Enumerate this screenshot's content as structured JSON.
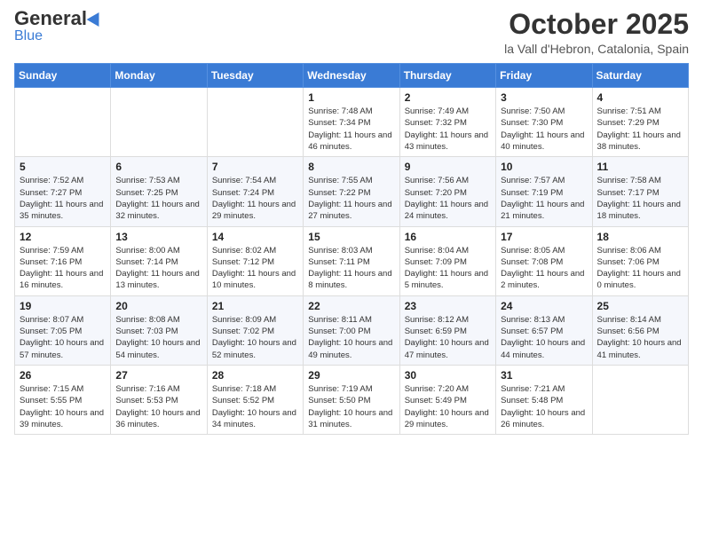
{
  "logo": {
    "general": "General",
    "blue": "Blue"
  },
  "header": {
    "title": "October 2025",
    "location": "la Vall d'Hebron, Catalonia, Spain"
  },
  "weekdays": [
    "Sunday",
    "Monday",
    "Tuesday",
    "Wednesday",
    "Thursday",
    "Friday",
    "Saturday"
  ],
  "weeks": [
    [
      {
        "day": "",
        "sunrise": "",
        "sunset": "",
        "daylight": ""
      },
      {
        "day": "",
        "sunrise": "",
        "sunset": "",
        "daylight": ""
      },
      {
        "day": "",
        "sunrise": "",
        "sunset": "",
        "daylight": ""
      },
      {
        "day": "1",
        "sunrise": "Sunrise: 7:48 AM",
        "sunset": "Sunset: 7:34 PM",
        "daylight": "Daylight: 11 hours and 46 minutes."
      },
      {
        "day": "2",
        "sunrise": "Sunrise: 7:49 AM",
        "sunset": "Sunset: 7:32 PM",
        "daylight": "Daylight: 11 hours and 43 minutes."
      },
      {
        "day": "3",
        "sunrise": "Sunrise: 7:50 AM",
        "sunset": "Sunset: 7:30 PM",
        "daylight": "Daylight: 11 hours and 40 minutes."
      },
      {
        "day": "4",
        "sunrise": "Sunrise: 7:51 AM",
        "sunset": "Sunset: 7:29 PM",
        "daylight": "Daylight: 11 hours and 38 minutes."
      }
    ],
    [
      {
        "day": "5",
        "sunrise": "Sunrise: 7:52 AM",
        "sunset": "Sunset: 7:27 PM",
        "daylight": "Daylight: 11 hours and 35 minutes."
      },
      {
        "day": "6",
        "sunrise": "Sunrise: 7:53 AM",
        "sunset": "Sunset: 7:25 PM",
        "daylight": "Daylight: 11 hours and 32 minutes."
      },
      {
        "day": "7",
        "sunrise": "Sunrise: 7:54 AM",
        "sunset": "Sunset: 7:24 PM",
        "daylight": "Daylight: 11 hours and 29 minutes."
      },
      {
        "day": "8",
        "sunrise": "Sunrise: 7:55 AM",
        "sunset": "Sunset: 7:22 PM",
        "daylight": "Daylight: 11 hours and 27 minutes."
      },
      {
        "day": "9",
        "sunrise": "Sunrise: 7:56 AM",
        "sunset": "Sunset: 7:20 PM",
        "daylight": "Daylight: 11 hours and 24 minutes."
      },
      {
        "day": "10",
        "sunrise": "Sunrise: 7:57 AM",
        "sunset": "Sunset: 7:19 PM",
        "daylight": "Daylight: 11 hours and 21 minutes."
      },
      {
        "day": "11",
        "sunrise": "Sunrise: 7:58 AM",
        "sunset": "Sunset: 7:17 PM",
        "daylight": "Daylight: 11 hours and 18 minutes."
      }
    ],
    [
      {
        "day": "12",
        "sunrise": "Sunrise: 7:59 AM",
        "sunset": "Sunset: 7:16 PM",
        "daylight": "Daylight: 11 hours and 16 minutes."
      },
      {
        "day": "13",
        "sunrise": "Sunrise: 8:00 AM",
        "sunset": "Sunset: 7:14 PM",
        "daylight": "Daylight: 11 hours and 13 minutes."
      },
      {
        "day": "14",
        "sunrise": "Sunrise: 8:02 AM",
        "sunset": "Sunset: 7:12 PM",
        "daylight": "Daylight: 11 hours and 10 minutes."
      },
      {
        "day": "15",
        "sunrise": "Sunrise: 8:03 AM",
        "sunset": "Sunset: 7:11 PM",
        "daylight": "Daylight: 11 hours and 8 minutes."
      },
      {
        "day": "16",
        "sunrise": "Sunrise: 8:04 AM",
        "sunset": "Sunset: 7:09 PM",
        "daylight": "Daylight: 11 hours and 5 minutes."
      },
      {
        "day": "17",
        "sunrise": "Sunrise: 8:05 AM",
        "sunset": "Sunset: 7:08 PM",
        "daylight": "Daylight: 11 hours and 2 minutes."
      },
      {
        "day": "18",
        "sunrise": "Sunrise: 8:06 AM",
        "sunset": "Sunset: 7:06 PM",
        "daylight": "Daylight: 11 hours and 0 minutes."
      }
    ],
    [
      {
        "day": "19",
        "sunrise": "Sunrise: 8:07 AM",
        "sunset": "Sunset: 7:05 PM",
        "daylight": "Daylight: 10 hours and 57 minutes."
      },
      {
        "day": "20",
        "sunrise": "Sunrise: 8:08 AM",
        "sunset": "Sunset: 7:03 PM",
        "daylight": "Daylight: 10 hours and 54 minutes."
      },
      {
        "day": "21",
        "sunrise": "Sunrise: 8:09 AM",
        "sunset": "Sunset: 7:02 PM",
        "daylight": "Daylight: 10 hours and 52 minutes."
      },
      {
        "day": "22",
        "sunrise": "Sunrise: 8:11 AM",
        "sunset": "Sunset: 7:00 PM",
        "daylight": "Daylight: 10 hours and 49 minutes."
      },
      {
        "day": "23",
        "sunrise": "Sunrise: 8:12 AM",
        "sunset": "Sunset: 6:59 PM",
        "daylight": "Daylight: 10 hours and 47 minutes."
      },
      {
        "day": "24",
        "sunrise": "Sunrise: 8:13 AM",
        "sunset": "Sunset: 6:57 PM",
        "daylight": "Daylight: 10 hours and 44 minutes."
      },
      {
        "day": "25",
        "sunrise": "Sunrise: 8:14 AM",
        "sunset": "Sunset: 6:56 PM",
        "daylight": "Daylight: 10 hours and 41 minutes."
      }
    ],
    [
      {
        "day": "26",
        "sunrise": "Sunrise: 7:15 AM",
        "sunset": "Sunset: 5:55 PM",
        "daylight": "Daylight: 10 hours and 39 minutes."
      },
      {
        "day": "27",
        "sunrise": "Sunrise: 7:16 AM",
        "sunset": "Sunset: 5:53 PM",
        "daylight": "Daylight: 10 hours and 36 minutes."
      },
      {
        "day": "28",
        "sunrise": "Sunrise: 7:18 AM",
        "sunset": "Sunset: 5:52 PM",
        "daylight": "Daylight: 10 hours and 34 minutes."
      },
      {
        "day": "29",
        "sunrise": "Sunrise: 7:19 AM",
        "sunset": "Sunset: 5:50 PM",
        "daylight": "Daylight: 10 hours and 31 minutes."
      },
      {
        "day": "30",
        "sunrise": "Sunrise: 7:20 AM",
        "sunset": "Sunset: 5:49 PM",
        "daylight": "Daylight: 10 hours and 29 minutes."
      },
      {
        "day": "31",
        "sunrise": "Sunrise: 7:21 AM",
        "sunset": "Sunset: 5:48 PM",
        "daylight": "Daylight: 10 hours and 26 minutes."
      },
      {
        "day": "",
        "sunrise": "",
        "sunset": "",
        "daylight": ""
      }
    ]
  ]
}
